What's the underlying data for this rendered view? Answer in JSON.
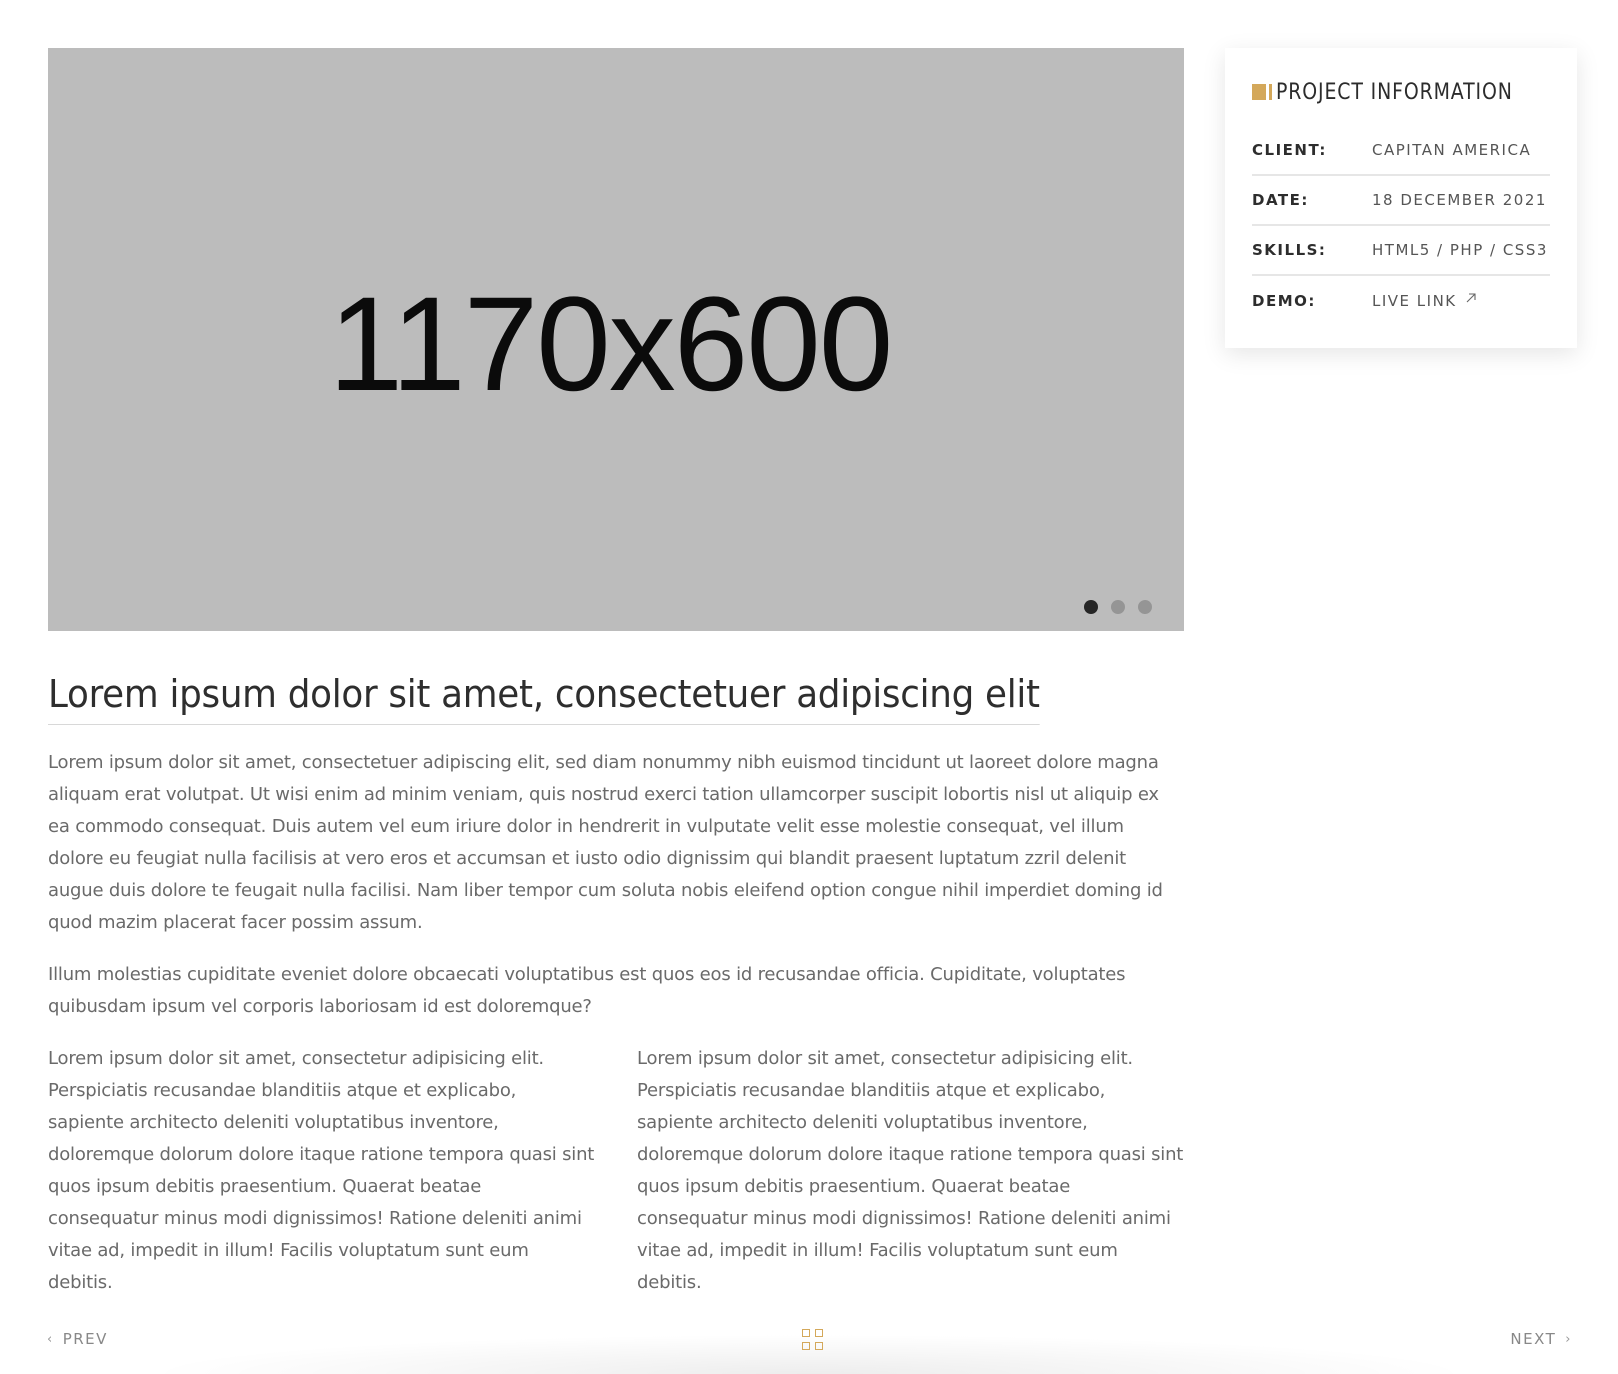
{
  "slider": {
    "placeholder_text": "1170x600",
    "dots_count": 3,
    "active_dot": 0
  },
  "project_info": {
    "title": "PROJECT INFORMATION",
    "accent_color": "#d4a85a",
    "rows": [
      {
        "label": "CLIENT:",
        "value": "CAPITAN AMERICA"
      },
      {
        "label": "DATE:",
        "value": "18 DECEMBER 2021"
      },
      {
        "label": "SKILLS:",
        "value": "HTML5 / PHP / CSS3"
      },
      {
        "label": "DEMO:",
        "value": "LIVE LINK",
        "icon": "external-link-arrow-icon"
      }
    ]
  },
  "content": {
    "heading": "Lorem ipsum dolor sit amet, consectetuer adipiscing elit",
    "paragraph_1": "Lorem ipsum dolor sit amet, consectetuer adipiscing elit, sed diam nonummy nibh euismod tincidunt ut laoreet dolore magna aliquam erat volutpat. Ut wisi enim ad minim veniam, quis nostrud exerci tation ullamcorper suscipit lobortis nisl ut aliquip ex ea commodo consequat. Duis autem vel eum iriure dolor in hendrerit in vulputate velit esse molestie consequat, vel illum dolore eu feugiat nulla facilisis at vero eros et accumsan et iusto odio dignissim qui blandit praesent luptatum zzril delenit augue duis dolore te feugait nulla facilisi. Nam liber tempor cum soluta nobis eleifend option congue nihil imperdiet doming id quod mazim placerat facer possim assum.",
    "paragraph_2": "Illum molestias cupiditate eveniet dolore obcaecati voluptatibus est quos eos id recusandae officia. Cupiditate, voluptates quibusdam ipsum vel corporis laboriosam id est doloremque?",
    "column_left": "Lorem ipsum dolor sit amet, consectetur adipisicing elit. Perspiciatis recusandae blanditiis atque et explicabo, sapiente architecto deleniti voluptatibus inventore, doloremque dolorum dolore itaque ratione tempora quasi sint quos ipsum debitis praesentium. Quaerat beatae consequatur minus modi dignissimos! Ratione deleniti animi vitae ad, impedit in illum! Facilis voluptatum sunt eum debitis.",
    "column_right": "Lorem ipsum dolor sit amet, consectetur adipisicing elit. Perspiciatis recusandae blanditiis atque et explicabo, sapiente architecto deleniti voluptatibus inventore, doloremque dolorum dolore itaque ratione tempora quasi sint quos ipsum debitis praesentium. Quaerat beatae consequatur minus modi dignissimos! Ratione deleniti animi vitae ad, impedit in illum! Facilis voluptatum sunt eum debitis."
  },
  "navigation": {
    "prev_label": "PREV",
    "next_label": "NEXT",
    "prev_icon": "chevron-left-icon",
    "next_icon": "chevron-right-icon",
    "grid_icon": "grid-icon"
  }
}
